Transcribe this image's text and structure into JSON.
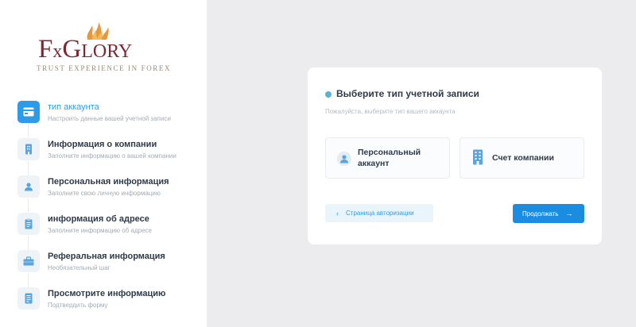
{
  "brand": {
    "logo_text_big_f": "F",
    "logo_text_x": "x",
    "logo_text_big_g": "G",
    "logo_text_rest": "LORY",
    "tagline": "TRUST EXPERIENCE IN FOREX",
    "color": "#7a2a35"
  },
  "steps": [
    {
      "title": "тип аккаунта",
      "subtitle": "Настроить данные вашей учетной записи",
      "icon": "card-icon",
      "active": true
    },
    {
      "title": "Информация о компании",
      "subtitle": "Заполните информацию о вашей компании",
      "icon": "building-icon",
      "active": false
    },
    {
      "title": "Персональная информация",
      "subtitle": "Заполните свою личную информацию",
      "icon": "user-icon",
      "active": false
    },
    {
      "title": "информация об адресе",
      "subtitle": "Заполните информацию об адресе",
      "icon": "clipboard-icon",
      "active": false
    },
    {
      "title": "Реферальная информация",
      "subtitle": "Необязательный шаг",
      "icon": "referral-icon",
      "active": false
    },
    {
      "title": "Просмотрите информацию",
      "subtitle": "Подтвердить форму",
      "icon": "document-icon",
      "active": false
    }
  ],
  "card": {
    "title": "Выберите тип учетной записи",
    "subtitle": "Пожалуйста, выберите тип вашего аккаунта",
    "options": [
      {
        "label": "Персональный аккаунт",
        "icon": "user-icon"
      },
      {
        "label": "Счет компании",
        "icon": "building-icon"
      }
    ],
    "back_label": "Страница авторизации",
    "next_label": "Продолжать"
  },
  "colors": {
    "accent": "#2d9ce8",
    "primary_button": "#1a8de0"
  }
}
